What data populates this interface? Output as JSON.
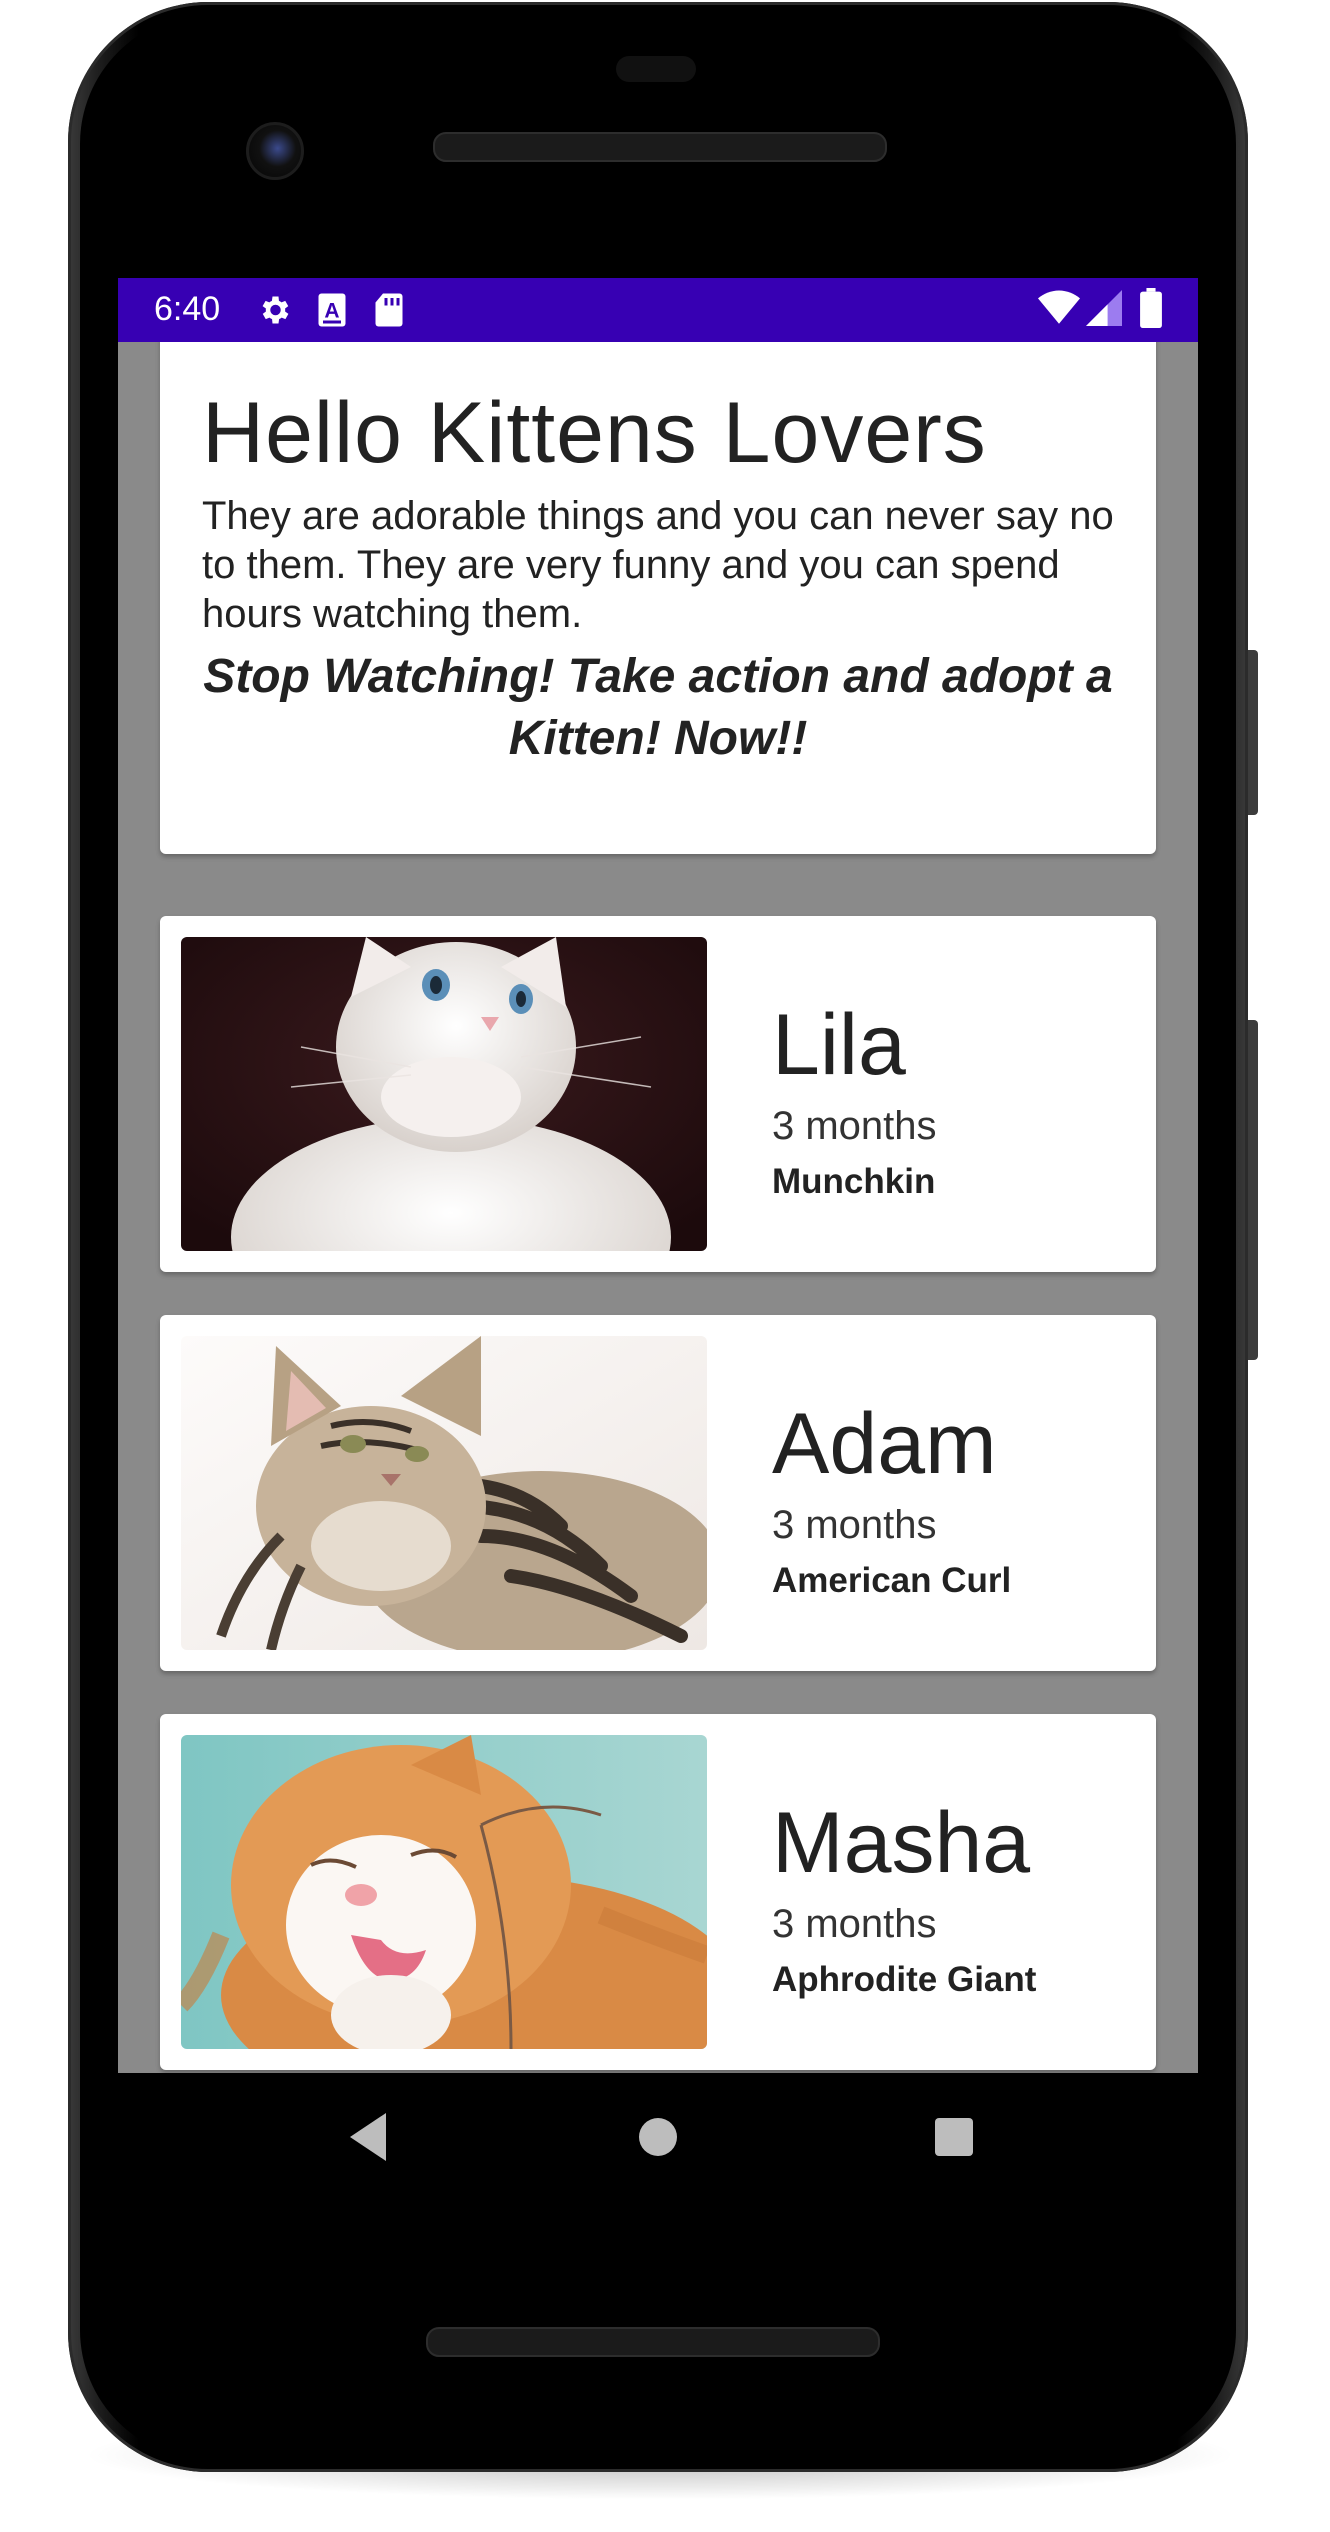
{
  "status_bar": {
    "time": "6:40",
    "left_icons": [
      "settings-icon",
      "font-a-icon",
      "sd-card-icon"
    ],
    "right_icons": [
      "wifi-icon",
      "cell-signal-icon",
      "battery-icon"
    ],
    "color": "#3700b3"
  },
  "intro": {
    "title": "Hello Kittens Lovers",
    "body": "They are adorable things and you can never say no to them. They are very funny and you can spend hours watching them.",
    "cta": "Stop Watching! Take action and adopt a Kitten! Now!!"
  },
  "kittens": [
    {
      "name": "Lila",
      "age": "3 months",
      "breed": "Munchkin",
      "photo": "white-kitten-photo"
    },
    {
      "name": "Adam",
      "age": "3 months",
      "breed": "American Curl",
      "photo": "tabby-kitten-photo"
    },
    {
      "name": "Masha",
      "age": "3 months",
      "breed": "Aphrodite Giant",
      "photo": "orange-kitten-photo"
    }
  ],
  "nav_bar": {
    "buttons": [
      "back-icon",
      "home-icon",
      "recents-icon"
    ]
  },
  "colors": {
    "background": "#8a8a8a",
    "card": "#ffffff",
    "text": "#222222"
  }
}
